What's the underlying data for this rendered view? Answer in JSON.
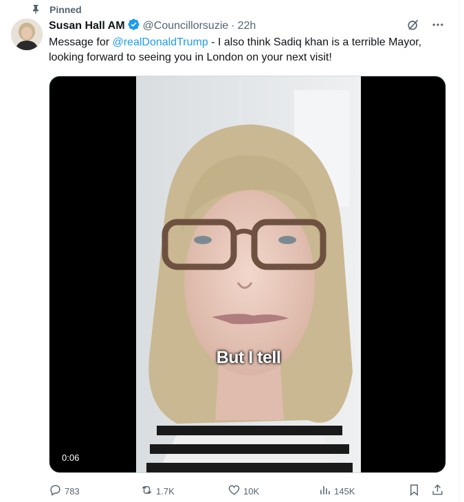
{
  "pinned": {
    "label": "Pinned",
    "icon": "pin-icon"
  },
  "tweet": {
    "author_name": "Susan Hall AM",
    "handle": "@Councillorsuzie",
    "separator": "·",
    "time": "22h",
    "text_prefix": "Message for ",
    "mention": "@realDonaldTrump",
    "text_suffix": " - I also think Sadiq khan is a terrible Mayor, looking forward to seeing you in London on your next visit!"
  },
  "video": {
    "caption": "But I tell",
    "timestamp": "0:06"
  },
  "actions": {
    "replies": "783",
    "reposts": "1.7K",
    "likes": "10K",
    "views": "145K"
  },
  "colors": {
    "accent": "#1d9bf0",
    "muted": "#536471",
    "text": "#0f1419"
  }
}
